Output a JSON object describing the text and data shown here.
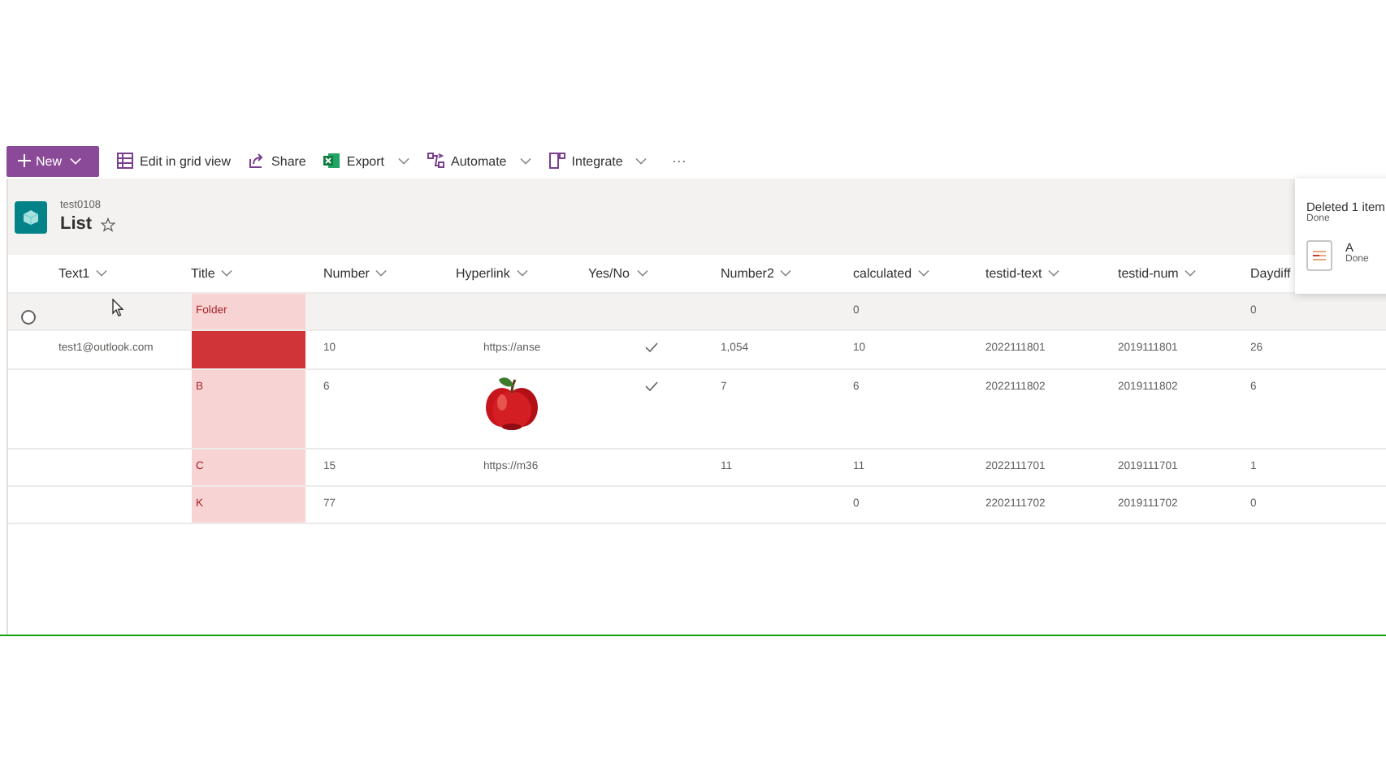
{
  "command_bar": {
    "new_button": "New",
    "items": [
      {
        "kind": "grid",
        "label": "Edit in grid view",
        "menu": false
      },
      {
        "kind": "share",
        "label": "Share",
        "menu": false
      },
      {
        "kind": "excel",
        "label": "Export",
        "menu": true
      },
      {
        "kind": "flow",
        "label": "Automate",
        "menu": true
      },
      {
        "kind": "integrate",
        "label": "Integrate",
        "menu": true
      }
    ],
    "more": "···"
  },
  "list_header": {
    "site": "test0108",
    "title": "List",
    "favorite": false
  },
  "table": {
    "columns": [
      "Text1",
      "Title",
      "Number",
      "Hyperlink",
      "Yes/No",
      "Number2",
      "calculated",
      "testid-text",
      "testid-num",
      "Daydiff"
    ],
    "rows": [
      {
        "hovered": true,
        "title": "Folder",
        "color": "#f8d3d3",
        "yes_no": false,
        "calculated": "0",
        "daydiff": "0"
      },
      {
        "hovered": false,
        "text1": "test1@outlook.com",
        "color": "#d13438",
        "number": "10",
        "hyperlink": "https://anse",
        "yes_no": true,
        "number2": "1,054",
        "calculated": "10",
        "testid_text": "2022111801",
        "testid_num": "2019111801",
        "daydiff": "26"
      },
      {
        "hovered": false,
        "title": "B",
        "color": "#f8d3d3",
        "number": "6",
        "yes_no": true,
        "number2": "7",
        "calculated": "6",
        "testid_text": "2022111802",
        "testid_num": "2019111802",
        "daydiff": "6"
      },
      {
        "hovered": false,
        "title": "C",
        "color": "#f8d3d3",
        "number": "15",
        "hyperlink": "https://m36",
        "yes_no": false,
        "number2": "11",
        "calculated": "11",
        "testid_text": "2022111701",
        "testid_num": "2019111701",
        "daydiff": "1"
      },
      {
        "hovered": false,
        "title": "K",
        "color": "#f8d3d3",
        "number": "77",
        "yes_no": false,
        "calculated": "0",
        "testid_text": "2202111702",
        "testid_num": "2019111702",
        "daydiff": "0"
      }
    ]
  },
  "toast": {
    "title": "Deleted 1 item",
    "status": "Done",
    "item": {
      "name": "A",
      "status": "Done"
    }
  }
}
